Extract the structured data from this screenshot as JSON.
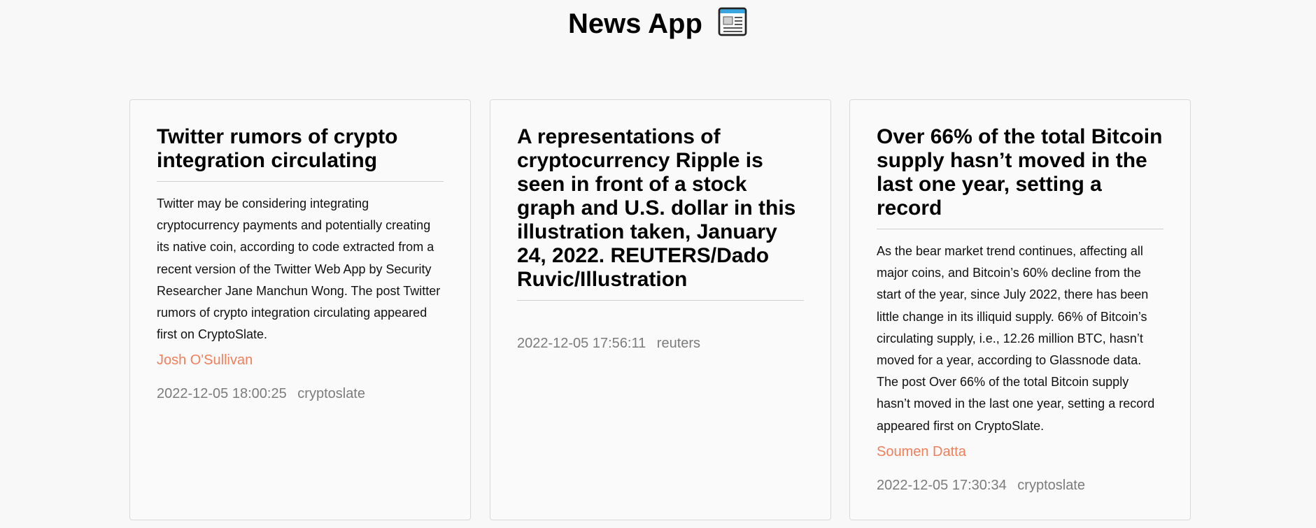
{
  "app": {
    "title": "News App",
    "title_icon": "newspaper-icon"
  },
  "articles": [
    {
      "title": "Twitter rumors of crypto integration circulating",
      "description": "Twitter may be considering integrating cryptocurrency payments and potentially creating its native coin, according to code extracted from a recent version of the Twitter Web App by Security Researcher Jane Manchun Wong. The post Twitter rumors of crypto integration circulating appeared first on CryptoSlate.",
      "author": "Josh O'Sullivan",
      "published": "2022-12-05 18:00:25",
      "source": "cryptoslate"
    },
    {
      "title": "A representations of cryptocurrency Ripple is seen in front of a stock graph and U.S. dollar in this illustration taken, January 24, 2022. REUTERS/Dado Ruvic/Illustration",
      "description": "",
      "author": "",
      "published": "2022-12-05 17:56:11",
      "source": "reuters"
    },
    {
      "title": "Over 66% of the total Bitcoin supply hasn’t moved in the last one year, setting a record",
      "description": "As the bear market trend continues, affecting all major coins, and Bitcoin’s 60% decline from the start of the year, since July 2022, there has been little change in its illiquid supply. 66% of Bitcoin’s circulating supply, i.e., 12.26 million BTC, hasn’t moved for a year, according to Glassnode data. The post Over 66% of the total Bitcoin supply hasn’t moved in the last one year, setting a record appeared first on CryptoSlate.",
      "author": "Soumen Datta",
      "published": "2022-12-05 17:30:34",
      "source": "cryptoslate"
    }
  ],
  "colors": {
    "author": "#f07f5a",
    "meta": "#7c7c7c",
    "card_border": "#d9d9d9",
    "background": "#f8f8f8"
  }
}
